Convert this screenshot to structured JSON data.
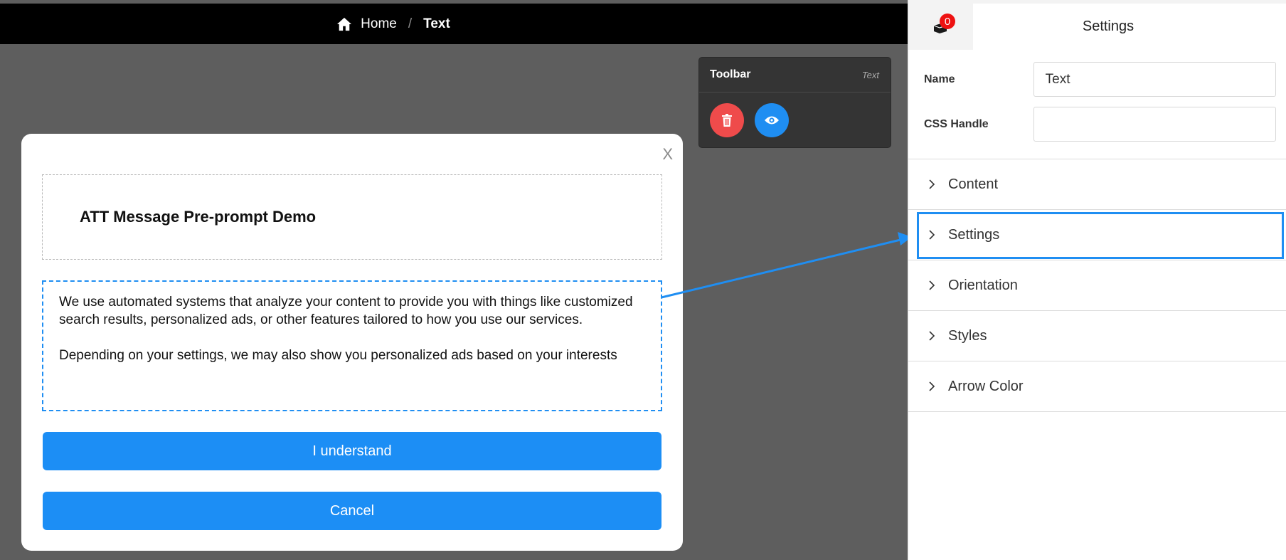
{
  "breadcrumb": {
    "home": "Home",
    "separator": "/",
    "current": "Text"
  },
  "toolbar": {
    "title": "Toolbar",
    "tag": "Text",
    "delete_icon": "trash-icon",
    "preview_icon": "eye-icon"
  },
  "modal": {
    "close": "X",
    "title": "ATT Message Pre-prompt Demo",
    "body_p1": "We use automated systems that analyze your content to provide you with things like customized search results, personalized ads, or other features tailored to how you use our services.",
    "body_p2": "Depending on your settings, we may also show you personalized ads based on your interests",
    "understand_label": "I understand",
    "cancel_label": "Cancel"
  },
  "panel": {
    "title": "Settings",
    "badge_count": "0",
    "name_label": "Name",
    "name_value": "Text",
    "css_handle_label": "CSS Handle",
    "css_handle_value": "",
    "sections": [
      "Content",
      "Settings",
      "Orientation",
      "Styles",
      "Arrow Color"
    ]
  },
  "colors": {
    "accent": "#1f8ef2",
    "danger": "#ef4b4b",
    "canvas": "#5e5e5e"
  }
}
